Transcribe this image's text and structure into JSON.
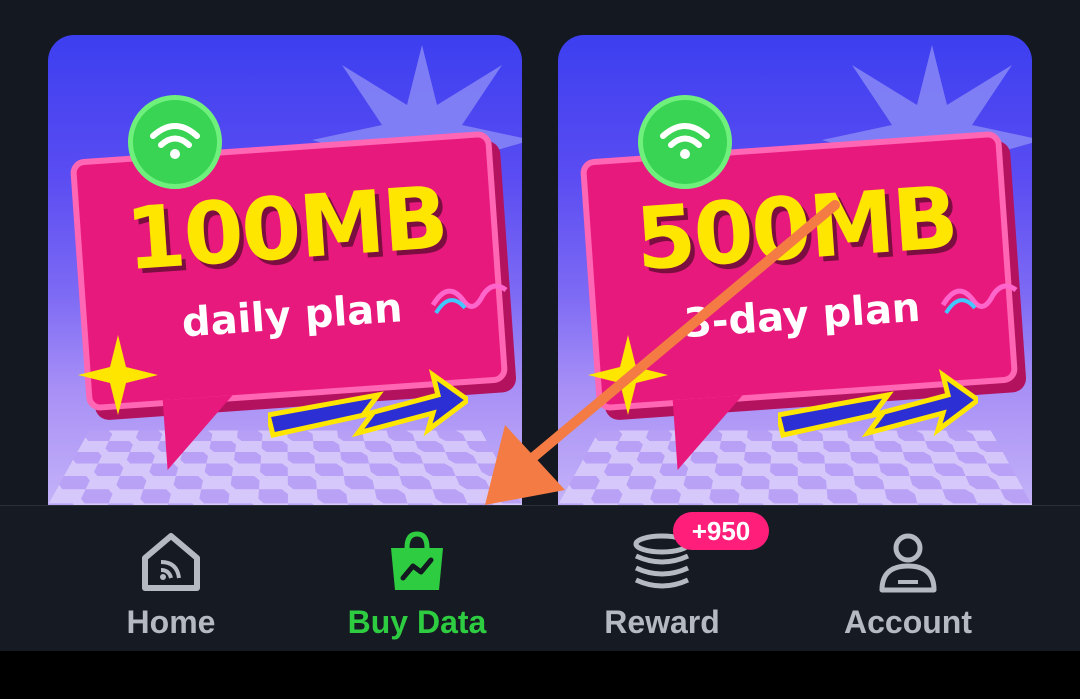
{
  "cards": [
    {
      "size": "100MB",
      "plan": "daily plan"
    },
    {
      "size": "500MB",
      "plan": "3-day plan"
    }
  ],
  "nav": {
    "items": [
      {
        "label": "Home",
        "icon": "home-icon"
      },
      {
        "label": "Buy Data",
        "icon": "shopping-bag-icon",
        "active": true
      },
      {
        "label": "Reward",
        "icon": "coins-icon"
      },
      {
        "label": "Account",
        "icon": "user-icon"
      }
    ],
    "reward_badge": "+950"
  },
  "colors": {
    "active": "#2ecc40",
    "inactive": "#b5b9c2",
    "badge": "#ff1f7a",
    "annotation_arrow": "#f47b44"
  }
}
